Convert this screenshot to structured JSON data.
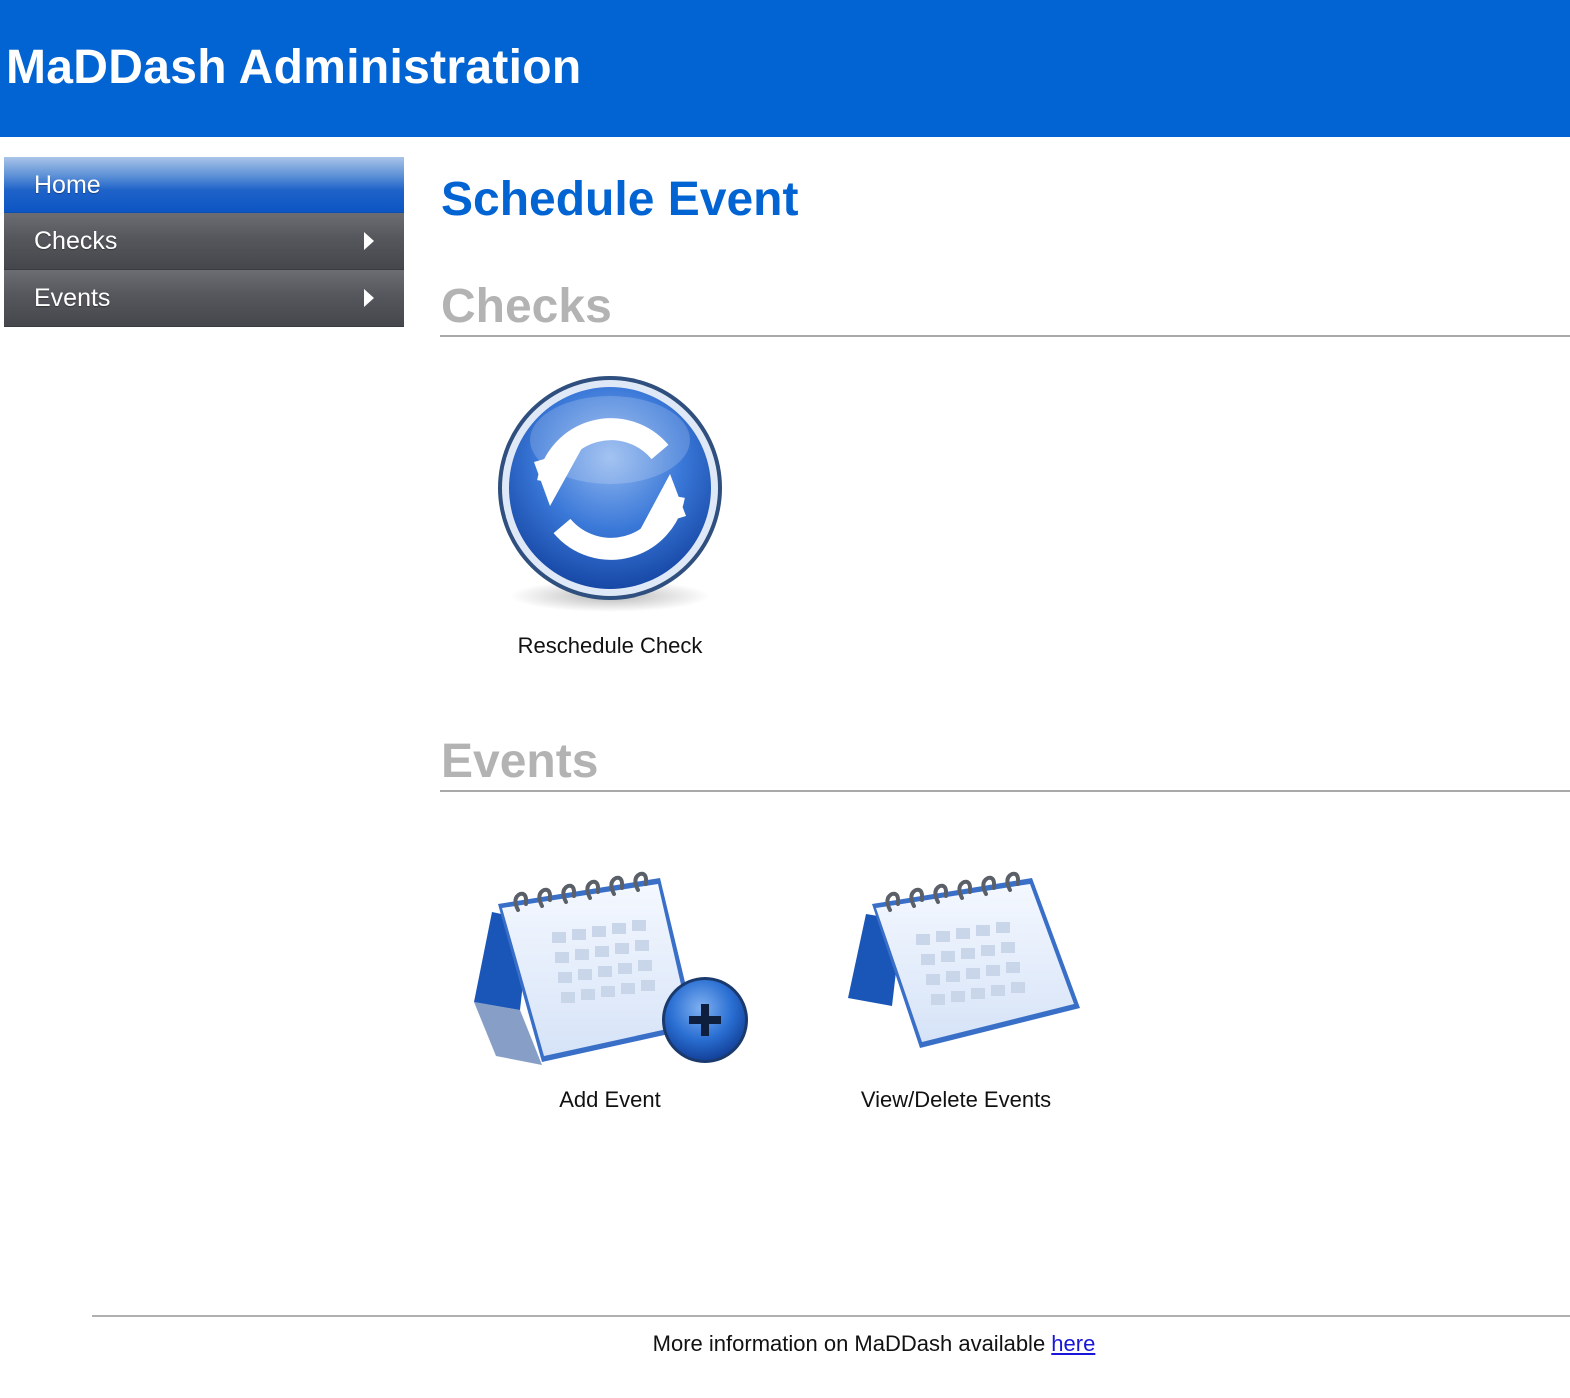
{
  "header": {
    "title": "MaDDash Administration",
    "background": "#0264d2"
  },
  "sidebar": {
    "items": [
      {
        "label": "Home",
        "active": true,
        "submenu": false
      },
      {
        "label": "Checks",
        "active": false,
        "submenu": true
      },
      {
        "label": "Events",
        "active": false,
        "submenu": true
      }
    ]
  },
  "main": {
    "title": "Schedule Event",
    "sections": [
      {
        "heading": "Checks",
        "tiles": [
          {
            "label": "Reschedule Check",
            "icon": "refresh-icon"
          }
        ]
      },
      {
        "heading": "Events",
        "tiles": [
          {
            "label": "Add Event",
            "icon": "calendar-add-icon"
          },
          {
            "label": "View/Delete Events",
            "icon": "calendar-icon"
          }
        ]
      }
    ]
  },
  "footer": {
    "text": "More information on MaDDash available ",
    "link_label": "here"
  },
  "colors": {
    "accent": "#0264d2",
    "section_heading": "#b3b3b3",
    "link": "#1a16d9"
  }
}
